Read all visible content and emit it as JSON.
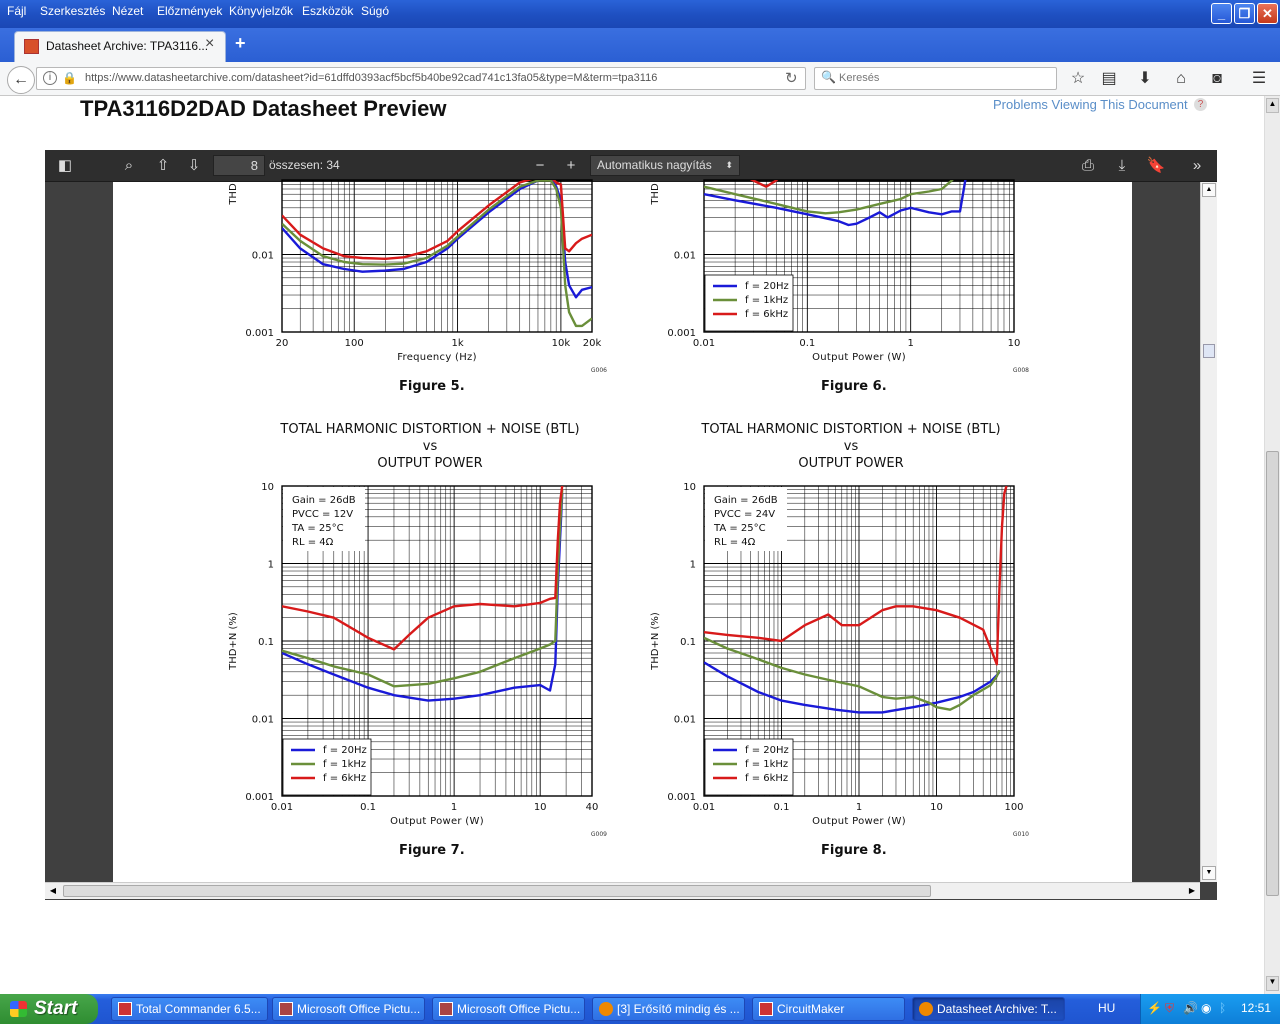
{
  "window": {
    "menu": [
      "Fájl",
      "Szerkesztés",
      "Nézet",
      "Előzmények",
      "Könyvjelzők",
      "Eszközök",
      "Súgó"
    ]
  },
  "tab": {
    "title": "Datasheet Archive: TPA3116...",
    "close": "×",
    "new_tab": "+"
  },
  "navbar": {
    "url": "https://www.datasheetarchive.com/datasheet?id=61dffd0393acf5bcf5b40be92cad741c13fa05&type=M&term=tpa3116",
    "search_placeholder": "Keresés"
  },
  "page": {
    "heading": "TPA3116D2DAD Datasheet Preview",
    "problems_link": "Problems Viewing This Document",
    "help": "?"
  },
  "pdf_toolbar": {
    "page_number": "8",
    "page_total": "összesen: 34",
    "zoom": "Automatikus nagyítás"
  },
  "figures": {
    "fig5": {
      "caption": "Figure 5."
    },
    "fig6": {
      "caption": "Figure 6."
    },
    "fig7": {
      "caption": "Figure 7.",
      "title1": "TOTAL HARMONIC DISTORTION + NOISE (BTL)",
      "title2": "vs",
      "title3": "OUTPUT POWER"
    },
    "fig8": {
      "caption": "Figure 8.",
      "title1": "TOTAL HARMONIC DISTORTION + NOISE (BTL)",
      "title2": "vs",
      "title3": "OUTPUT POWER"
    }
  },
  "chart_data": [
    {
      "id": "fig5",
      "type": "line",
      "xscale": "log",
      "yscale": "log",
      "xlabel": "Frequency (Hz)",
      "ylabel": "THD",
      "xlim": [
        20,
        20000
      ],
      "ylim": [
        0.001,
        0.1
      ],
      "xticks": [
        "20",
        "100",
        "1k",
        "10k",
        "20k"
      ],
      "yticks": [
        "0.001",
        "0.01"
      ],
      "code": "G006",
      "series": [
        {
          "color": "#1a1ad8",
          "x": [
            20,
            30,
            50,
            80,
            120,
            200,
            300,
            500,
            800,
            1000,
            2000,
            4000,
            6000,
            8000,
            9000,
            10000,
            11000,
            12000,
            14000,
            16000,
            20000
          ],
          "y": [
            0.022,
            0.012,
            0.0075,
            0.0065,
            0.006,
            0.0062,
            0.0065,
            0.008,
            0.012,
            0.016,
            0.035,
            0.07,
            0.09,
            0.095,
            0.075,
            0.05,
            0.008,
            0.004,
            0.0028,
            0.0035,
            0.0038
          ]
        },
        {
          "color": "#6a8f3a",
          "x": [
            20,
            30,
            50,
            80,
            120,
            200,
            300,
            500,
            800,
            1000,
            2000,
            4000,
            6000,
            8000,
            9000,
            10000,
            11000,
            12000,
            14000,
            16000,
            20000
          ],
          "y": [
            0.025,
            0.015,
            0.0095,
            0.008,
            0.0075,
            0.0074,
            0.0076,
            0.009,
            0.013,
            0.017,
            0.038,
            0.075,
            0.09,
            0.09,
            0.07,
            0.04,
            0.004,
            0.0018,
            0.0012,
            0.0012,
            0.0015
          ]
        },
        {
          "color": "#d81a1a",
          "x": [
            20,
            30,
            50,
            80,
            120,
            200,
            300,
            500,
            800,
            1000,
            2000,
            4000,
            6000,
            8000,
            9000,
            10000,
            11000,
            12000,
            14000,
            16000,
            20000
          ],
          "y": [
            0.032,
            0.018,
            0.012,
            0.0095,
            0.009,
            0.0088,
            0.0092,
            0.011,
            0.015,
            0.02,
            0.043,
            0.085,
            0.1,
            0.1,
            0.085,
            0.08,
            0.012,
            0.011,
            0.014,
            0.016,
            0.018
          ]
        }
      ]
    },
    {
      "id": "fig6",
      "type": "line",
      "xscale": "log",
      "yscale": "log",
      "xlabel": "Output Power (W)",
      "ylabel": "THD",
      "xlim": [
        0.01,
        10
      ],
      "ylim": [
        0.001,
        0.1
      ],
      "xticks": [
        "0.01",
        "0.1",
        "1",
        "10"
      ],
      "yticks": [
        "0.001",
        "0.01"
      ],
      "code": "G008",
      "legend": [
        "f = 20Hz",
        "f = 1kHz",
        "f = 6kHz"
      ],
      "series": [
        {
          "name": "f = 20Hz",
          "color": "#1a1ad8",
          "x": [
            0.01,
            0.02,
            0.05,
            0.1,
            0.2,
            0.25,
            0.3,
            0.4,
            0.5,
            0.6,
            0.8,
            1,
            1.5,
            2,
            2.5,
            3,
            3.5
          ],
          "y": [
            0.06,
            0.05,
            0.04,
            0.033,
            0.027,
            0.024,
            0.025,
            0.03,
            0.035,
            0.03,
            0.037,
            0.04,
            0.035,
            0.033,
            0.036,
            0.036,
            0.12
          ]
        },
        {
          "name": "f = 1kHz",
          "color": "#6a8f3a",
          "x": [
            0.01,
            0.02,
            0.05,
            0.1,
            0.15,
            0.2,
            0.3,
            0.5,
            0.8,
            1,
            1.5,
            2,
            2.5,
            3
          ],
          "y": [
            0.075,
            0.06,
            0.045,
            0.036,
            0.034,
            0.035,
            0.038,
            0.045,
            0.052,
            0.06,
            0.065,
            0.07,
            0.09,
            0.12
          ]
        },
        {
          "name": "f = 6kHz",
          "color": "#d81a1a",
          "x": [
            0.02,
            0.03,
            0.04,
            0.05,
            0.06
          ],
          "y": [
            0.12,
            0.09,
            0.075,
            0.09,
            0.12
          ]
        }
      ]
    },
    {
      "id": "fig7",
      "type": "line",
      "xscale": "log",
      "yscale": "log",
      "xlabel": "Output Power (W)",
      "ylabel": "THD+N (%)",
      "xlim": [
        0.01,
        40
      ],
      "ylim": [
        0.001,
        10
      ],
      "xticks": [
        "0.01",
        "0.1",
        "1",
        "10",
        "40"
      ],
      "yticks": [
        "0.001",
        "0.01",
        "0.1",
        "1",
        "10"
      ],
      "code": "G009",
      "annotation": [
        "Gain = 26dB",
        "PVCC = 12V",
        "TA = 25°C",
        "RL = 4Ω"
      ],
      "legend": [
        "f = 20Hz",
        "f = 1kHz",
        "f = 6kHz"
      ],
      "series": [
        {
          "name": "f = 20Hz",
          "color": "#1a1ad8",
          "x": [
            0.01,
            0.02,
            0.04,
            0.1,
            0.2,
            0.5,
            1,
            2,
            5,
            10,
            13,
            15,
            16,
            17,
            18
          ],
          "y": [
            0.07,
            0.05,
            0.037,
            0.025,
            0.02,
            0.017,
            0.018,
            0.02,
            0.025,
            0.027,
            0.023,
            0.05,
            0.5,
            2,
            8
          ]
        },
        {
          "name": "f = 1kHz",
          "color": "#6a8f3a",
          "x": [
            0.01,
            0.02,
            0.04,
            0.1,
            0.2,
            0.5,
            1,
            2,
            5,
            10,
            13,
            15,
            16,
            17,
            18
          ],
          "y": [
            0.075,
            0.06,
            0.047,
            0.037,
            0.026,
            0.028,
            0.033,
            0.04,
            0.06,
            0.08,
            0.09,
            0.1,
            0.8,
            3,
            9
          ]
        },
        {
          "name": "f = 6kHz",
          "color": "#d81a1a",
          "x": [
            0.01,
            0.02,
            0.04,
            0.1,
            0.2,
            0.3,
            0.5,
            1,
            2,
            5,
            10,
            13,
            15,
            16,
            17,
            18
          ],
          "y": [
            0.28,
            0.24,
            0.2,
            0.11,
            0.078,
            0.12,
            0.2,
            0.28,
            0.3,
            0.28,
            0.31,
            0.35,
            0.36,
            2,
            6,
            10
          ]
        }
      ]
    },
    {
      "id": "fig8",
      "type": "line",
      "xscale": "log",
      "yscale": "log",
      "xlabel": "Output Power (W)",
      "ylabel": "THD+N (%)",
      "xlim": [
        0.01,
        100
      ],
      "ylim": [
        0.001,
        10
      ],
      "xticks": [
        "0.01",
        "0.1",
        "1",
        "10",
        "100"
      ],
      "yticks": [
        "0.001",
        "0.01",
        "0.1",
        "1",
        "10"
      ],
      "code": "G010",
      "annotation": [
        "Gain = 26dB",
        "PVCC = 24V",
        "TA = 25°C",
        "RL = 4Ω"
      ],
      "legend": [
        "f = 20Hz",
        "f = 1kHz",
        "f = 6kHz"
      ],
      "series": [
        {
          "name": "f = 20Hz",
          "color": "#1a1ad8",
          "x": [
            0.01,
            0.02,
            0.05,
            0.1,
            0.2,
            0.5,
            1,
            2,
            5,
            10,
            20,
            30,
            50,
            60,
            65
          ],
          "y": [
            0.053,
            0.035,
            0.022,
            0.017,
            0.015,
            0.013,
            0.012,
            0.012,
            0.014,
            0.016,
            0.019,
            0.022,
            0.03,
            0.036,
            0.04
          ]
        },
        {
          "name": "f = 1kHz",
          "color": "#6a8f3a",
          "x": [
            0.01,
            0.02,
            0.05,
            0.1,
            0.2,
            0.5,
            1,
            2,
            3,
            5,
            8,
            10,
            15,
            20,
            30,
            50,
            60,
            65
          ],
          "y": [
            0.11,
            0.08,
            0.058,
            0.045,
            0.037,
            0.03,
            0.026,
            0.019,
            0.018,
            0.019,
            0.016,
            0.014,
            0.013,
            0.015,
            0.02,
            0.027,
            0.035,
            0.042
          ]
        },
        {
          "name": "f = 6kHz",
          "color": "#d81a1a",
          "x": [
            0.01,
            0.02,
            0.05,
            0.1,
            0.2,
            0.4,
            0.6,
            1,
            2,
            3,
            5,
            10,
            20,
            40,
            50,
            60,
            65,
            70,
            75,
            80
          ],
          "y": [
            0.13,
            0.12,
            0.11,
            0.1,
            0.16,
            0.22,
            0.16,
            0.16,
            0.25,
            0.28,
            0.28,
            0.25,
            0.2,
            0.14,
            0.08,
            0.05,
            0.5,
            3,
            8,
            10
          ]
        }
      ]
    }
  ],
  "taskbar": {
    "start": "Start",
    "tasks": [
      "Total Commander 6.5...",
      "Microsoft Office Pictu...",
      "Microsoft Office Pictu...",
      "[3] Erősítő mindig és ...",
      "CircuitMaker",
      "Datasheet Archive: T..."
    ],
    "lang": "HU",
    "clock": "12:51"
  }
}
